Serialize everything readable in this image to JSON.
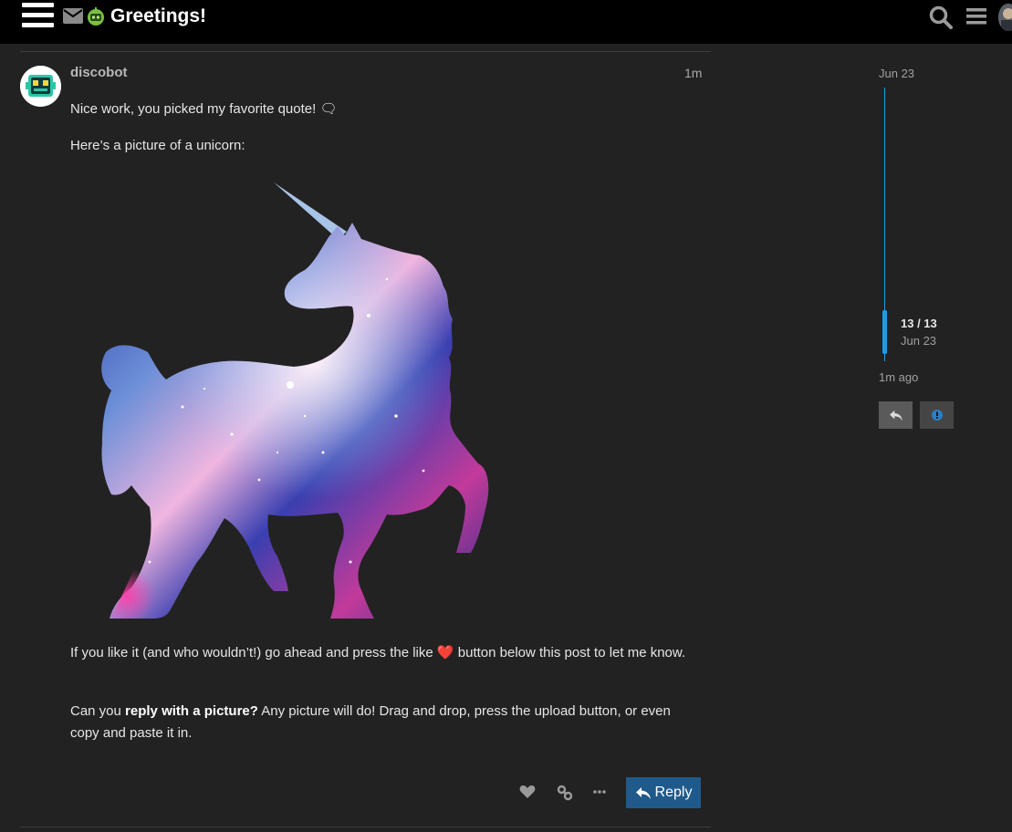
{
  "header": {
    "topic_title": "Greetings!"
  },
  "post": {
    "username": "discobot",
    "age": "1m",
    "paragraph1": "Nice work, you picked my favorite quote! 🗨",
    "paragraph2": "Here’s a picture of a unicorn:",
    "paragraph3_before": "If you like it (and who wouldn’t!) go ahead and press the like ",
    "paragraph3_emoji": "❤️",
    "paragraph3_after": " button below this post to let me know.",
    "paragraph4_before": "Can you ",
    "paragraph4_bold": "reply with a picture?",
    "paragraph4_after": " Any picture will do! Drag and drop, press the upload button, or even copy and paste it in.",
    "reply_label": "Reply"
  },
  "timeline": {
    "start_date": "Jun 23",
    "position": "13 / 13",
    "end_date": "Jun 23",
    "last_activity": "1m ago"
  },
  "colors": {
    "accent": "#1a9ee8",
    "reply_button": "#1f5a8a",
    "background": "#222222",
    "header": "#000000"
  }
}
